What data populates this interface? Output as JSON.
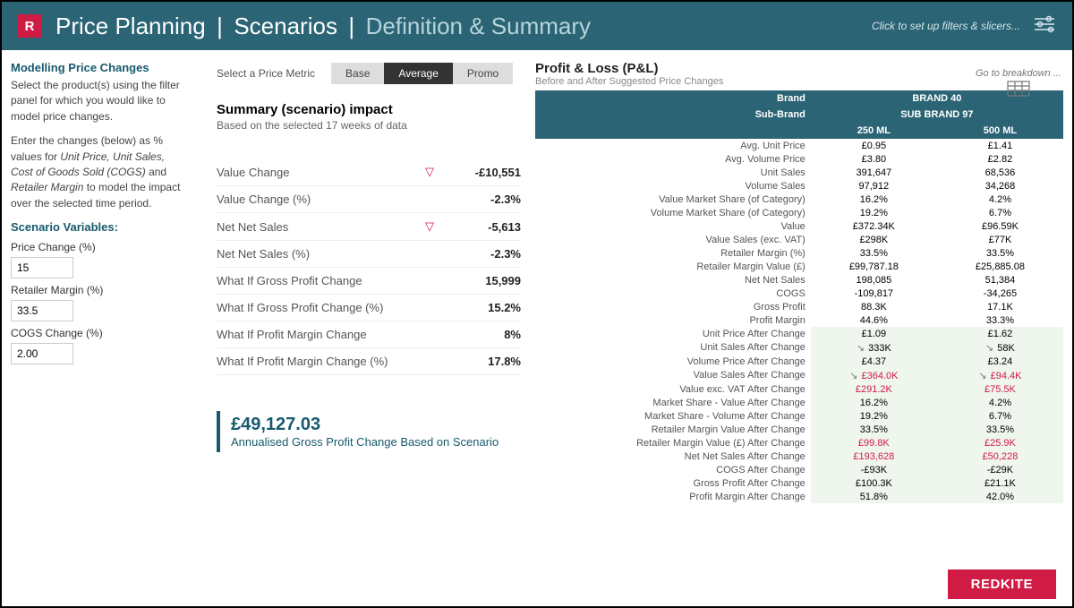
{
  "header": {
    "logo_letter": "R",
    "title_1": "Price Planning",
    "title_2": "Scenarios",
    "title_3": "Definition & Summary",
    "filters_link": "Click to set up filters & slicers..."
  },
  "sidebar": {
    "heading": "Modelling Price Changes",
    "para1": "Select the product(s) using the filter panel for which you would like to model price changes.",
    "para2_pre": "Enter the changes (below) as % values for ",
    "para2_em": "Unit Price, Unit Sales, Cost of Goods Sold (COGS)",
    "para2_mid": " and ",
    "para2_em2": "Retailer Margin",
    "para2_post": " to model the impact over the selected time period.",
    "vars_heading": "Scenario Variables:",
    "price_change_label": "Price Change (%)",
    "price_change_value": "15",
    "retailer_margin_label": "Retailer Margin (%)",
    "retailer_margin_value": "33.5",
    "cogs_change_label": "COGS Change (%)",
    "cogs_change_value": "2.00"
  },
  "middle": {
    "select_metric_label": "Select a Price Metric",
    "seg_base": "Base",
    "seg_average": "Average",
    "seg_promo": "Promo",
    "summary_title": "Summary (scenario) impact",
    "summary_sub": "Based on the selected 17 weeks of data",
    "rows": [
      {
        "label": "Value Change",
        "indicator": "▽",
        "value": "-£10,551"
      },
      {
        "label": "Value Change (%)",
        "indicator": "",
        "value": "-2.3%"
      },
      {
        "label": "Net Net Sales",
        "indicator": "▽",
        "value": "-5,613"
      },
      {
        "label": "Net Net Sales (%)",
        "indicator": "",
        "value": "-2.3%"
      },
      {
        "label": "What If Gross Profit Change",
        "indicator": "",
        "value": "15,999"
      },
      {
        "label": "What If Gross Profit Change (%)",
        "indicator": "",
        "value": "15.2%"
      },
      {
        "label": "What If Profit Margin Change",
        "indicator": "",
        "value": "8%"
      },
      {
        "label": "What If Profit Margin Change (%)",
        "indicator": "",
        "value": "17.8%"
      }
    ],
    "callout_value": "£49,127.03",
    "callout_desc": "Annualised Gross Profit Change Based on Scenario"
  },
  "pl": {
    "title": "Profit & Loss (P&L)",
    "subtitle": "Before and After Suggested Price Changes",
    "breakdown": "Go to breakdown ...",
    "brand_label": "Brand",
    "brand_value": "BRAND 40",
    "subbrand_label": "Sub-Brand",
    "subbrand_value": "SUB BRAND 97",
    "col1": "250 ML",
    "col2": "500 ML",
    "rows": [
      {
        "label": "Avg. Unit Price",
        "c1": "£0.95",
        "c2": "£1.41"
      },
      {
        "label": "Avg. Volume Price",
        "c1": "£3.80",
        "c2": "£2.82"
      },
      {
        "label": "Unit Sales",
        "c1": "391,647",
        "c2": "68,536"
      },
      {
        "label": "Volume Sales",
        "c1": "97,912",
        "c2": "34,268"
      },
      {
        "label": "Value Market Share (of Category)",
        "c1": "16.2%",
        "c2": "4.2%"
      },
      {
        "label": "Volume Market Share (of Category)",
        "c1": "19.2%",
        "c2": "6.7%"
      },
      {
        "label": "Value",
        "c1": "£372.34K",
        "c2": "£96.59K"
      },
      {
        "label": "Value Sales (exc. VAT)",
        "c1": "£298K",
        "c2": "£77K"
      },
      {
        "label": "Retailer Margin (%)",
        "c1": "33.5%",
        "c2": "33.5%"
      },
      {
        "label": "Retailer Margin Value (£)",
        "c1": "£99,787.18",
        "c2": "£25,885.08"
      },
      {
        "label": "Net Net Sales",
        "c1": "198,085",
        "c2": "51,384"
      },
      {
        "label": "COGS",
        "c1": "-109,817",
        "c2": "-34,265"
      },
      {
        "label": "Gross Profit",
        "c1": "88.3K",
        "c2": "17.1K"
      },
      {
        "label": "Profit Margin",
        "c1": "44.6%",
        "c2": "33.3%"
      }
    ],
    "after_rows": [
      {
        "label": "Unit Price After Change",
        "c1": "£1.09",
        "c2": "£1.62"
      },
      {
        "label": "Unit Sales After Change",
        "c1": "333K",
        "c2": "58K",
        "arrow": true
      },
      {
        "label": "Volume Price After Change",
        "c1": "£4.37",
        "c2": "£3.24"
      },
      {
        "label": "Value Sales After Change",
        "c1": "£364.0K",
        "c2": "£94.4K",
        "neg": true,
        "arrow": true
      },
      {
        "label": "Value exc. VAT After Change",
        "c1": "£291.2K",
        "c2": "£75.5K",
        "neg": true
      },
      {
        "label": "Market Share - Value After Change",
        "c1": "16.2%",
        "c2": "4.2%"
      },
      {
        "label": "Market Share - Volume After Change",
        "c1": "19.2%",
        "c2": "6.7%"
      },
      {
        "label": "Retailer Margin Value After Change",
        "c1": "33.5%",
        "c2": "33.5%"
      },
      {
        "label": "Retailer Margin Value (£) After Change",
        "c1": "£99.8K",
        "c2": "£25.9K",
        "neg": true
      },
      {
        "label": "Net Net Sales After Change",
        "c1": "£193,628",
        "c2": "£50,228",
        "neg": true
      },
      {
        "label": "COGS After Change",
        "c1": "-£93K",
        "c2": "-£29K"
      },
      {
        "label": "Gross Profit After Change",
        "c1": "£100.3K",
        "c2": "£21.1K"
      },
      {
        "label": "Profit Margin After Change",
        "c1": "51.8%",
        "c2": "42.0%"
      }
    ]
  },
  "footer": {
    "brand": "REDKITE"
  }
}
